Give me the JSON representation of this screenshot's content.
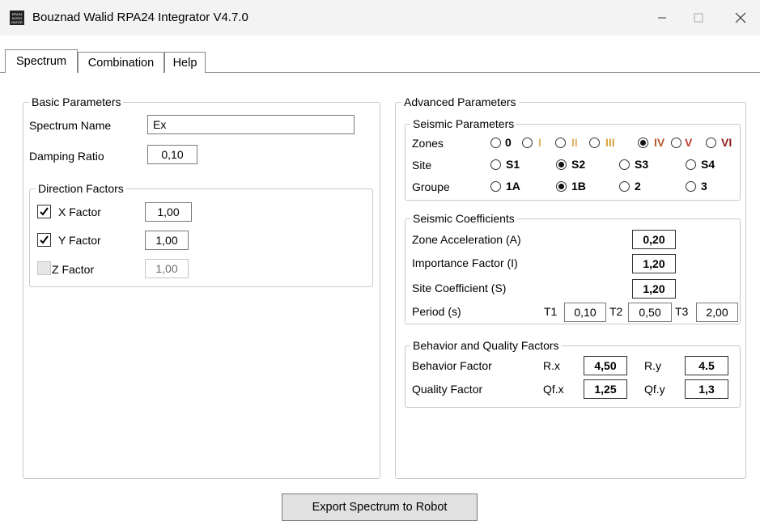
{
  "window": {
    "icon_text": [
      "RPA24",
      "INTEG",
      "RATOR"
    ],
    "title": "Bouznad Walid RPA24 Integrator V4.7.0"
  },
  "tabs": [
    {
      "label": "Spectrum",
      "active": true
    },
    {
      "label": "Combination",
      "active": false
    },
    {
      "label": "Help",
      "active": false
    }
  ],
  "basic": {
    "legend": "Basic Parameters",
    "spectrum_name_label": "Spectrum Name",
    "spectrum_name_value": "Ex",
    "damping_label": "Damping Ratio",
    "damping_value": "0,10",
    "direction": {
      "legend": "Direction Factors",
      "x": {
        "label": "X Factor",
        "value": "1,00",
        "checked": true
      },
      "y": {
        "label": "Y Factor",
        "value": "1,00",
        "checked": true
      },
      "z": {
        "label": "Z Factor",
        "value": "1,00",
        "checked": false
      }
    }
  },
  "advanced": {
    "legend": "Advanced Parameters",
    "seismic": {
      "legend": "Seismic Parameters",
      "zones_label": "Zones",
      "zones": [
        {
          "label": "0",
          "color": "#000000",
          "selected": false
        },
        {
          "label": "I",
          "color": "#e2b26a",
          "selected": false
        },
        {
          "label": "II",
          "color": "#e2b26a",
          "selected": false
        },
        {
          "label": "III",
          "color": "#d9a441",
          "selected": false
        },
        {
          "label": "IV",
          "color": "#b35a2c",
          "selected": true
        },
        {
          "label": "V",
          "color": "#c0392b",
          "selected": false
        },
        {
          "label": "VI",
          "color": "#8e1b1b",
          "selected": false
        }
      ],
      "site_label": "Site",
      "sites": [
        {
          "label": "S1",
          "selected": false
        },
        {
          "label": "S2",
          "selected": true
        },
        {
          "label": "S3",
          "selected": false
        },
        {
          "label": "S4",
          "selected": false
        }
      ],
      "groupe_label": "Groupe",
      "groups": [
        {
          "label": "1A",
          "selected": false
        },
        {
          "label": "1B",
          "selected": true
        },
        {
          "label": "2",
          "selected": false
        },
        {
          "label": "3",
          "selected": false
        }
      ]
    },
    "coefficients": {
      "legend": "Seismic Coefficients",
      "zone_accel_label": "Zone Acceleration (A)",
      "zone_accel_value": "0,20",
      "importance_label": "Importance Factor (I)",
      "importance_value": "1,20",
      "site_coef_label": "Site Coefficient (S)",
      "site_coef_value": "1,20",
      "period_label": "Period (s)",
      "t1_label": "T1",
      "t1_value": "0,10",
      "t2_label": "T2",
      "t2_value": "0,50",
      "t3_label": "T3",
      "t3_value": "2,00"
    },
    "behavior": {
      "legend": "Behavior and Quality Factors",
      "behavior_label": "Behavior Factor",
      "rx_label": "R.x",
      "rx_value": "4,50",
      "ry_label": "R.y",
      "ry_value": "4.5",
      "quality_label": "Quality Factor",
      "qfx_label": "Qf.x",
      "qfx_value": "1,25",
      "qfy_label": "Qf.y",
      "qfy_value": "1,3"
    }
  },
  "export_button": "Export Spectrum to Robot"
}
